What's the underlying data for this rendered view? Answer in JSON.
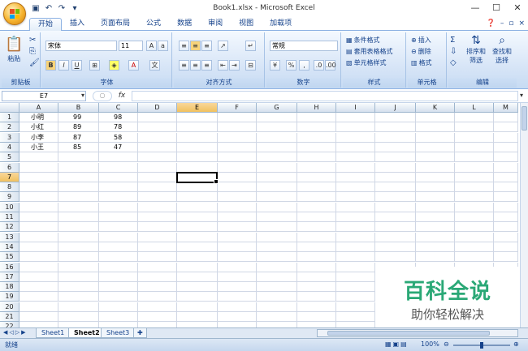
{
  "app": {
    "window_title": "Book1.xlsx - Microsoft Excel",
    "ctrl_minimize": "—",
    "ctrl_maximize": "☐",
    "ctrl_close": "✕"
  },
  "ribbon_tabs": [
    "开始",
    "插入",
    "页面布局",
    "公式",
    "数据",
    "审阅",
    "视图",
    "加载项"
  ],
  "ribbon": {
    "clipboard": {
      "paste": "粘贴",
      "label": "剪贴板"
    },
    "font": {
      "name": "宋体",
      "size": "11",
      "label": "字体"
    },
    "alignment": {
      "label": "对齐方式"
    },
    "number": {
      "format": "常规",
      "label": "数字"
    },
    "styles": {
      "conditional": "条件格式",
      "table": "套用表格格式",
      "cell": "单元格样式",
      "label": "样式"
    },
    "cells": {
      "insert": "插入",
      "delete": "删除",
      "format": "格式",
      "label": "单元格"
    },
    "editing": {
      "sort": "排序和",
      "sort2": "筛选",
      "find": "查找和",
      "find2": "选择",
      "label": "编辑"
    }
  },
  "formula_bar": {
    "name_box": "E7",
    "fx": "fx",
    "formula": ""
  },
  "grid": {
    "columns": [
      "A",
      "B",
      "C",
      "D",
      "E",
      "F",
      "G",
      "H",
      "I",
      "J",
      "K",
      "L",
      "M"
    ],
    "selected_column": "E",
    "selected_row": 7,
    "row_count": 22,
    "cells": [
      [
        "小明",
        "99",
        "98"
      ],
      [
        "小红",
        "89",
        "78"
      ],
      [
        "小李",
        "87",
        "58"
      ],
      [
        "小王",
        "85",
        "47"
      ]
    ]
  },
  "sheets": [
    "Sheet1",
    "Sheet2",
    "Sheet3"
  ],
  "active_sheet": "Sheet2",
  "status": {
    "ready": "就绪",
    "zoom": "100%"
  },
  "watermark": {
    "main": "百科全说",
    "sub": "助你轻松解决"
  },
  "colors": {
    "accent": "#15428b",
    "ribbon": "#d4e3f6",
    "watermark": "#2aa876"
  }
}
